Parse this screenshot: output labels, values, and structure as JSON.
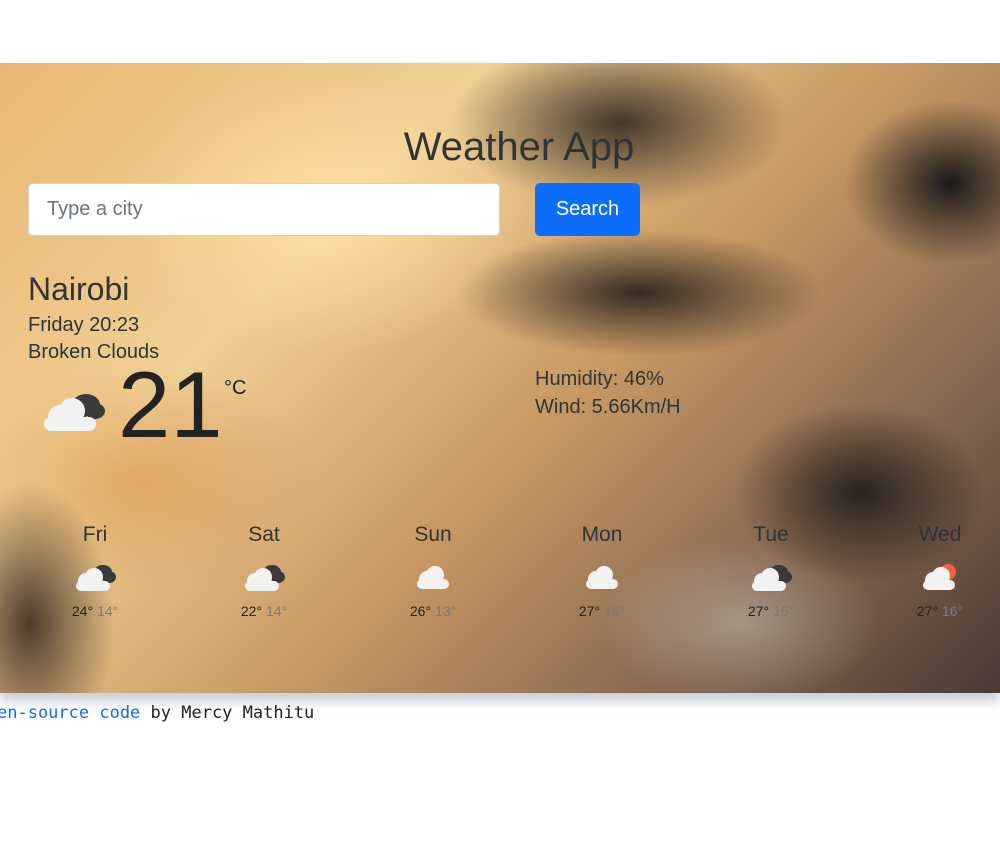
{
  "app": {
    "title": "Weather App"
  },
  "search": {
    "placeholder": "Type a city",
    "value": "",
    "button_label": "Search"
  },
  "current": {
    "city": "Nairobi",
    "datetime": "Friday 20:23",
    "description": "Broken Clouds",
    "icon": "broken-clouds-icon",
    "temperature": "21",
    "unit": "°C",
    "humidity": "Humidity: 46%",
    "wind": "Wind: 5.66Km/H"
  },
  "forecast": [
    {
      "day": "Fri",
      "icon": "broken-clouds-icon",
      "max": "24°",
      "min": "14°"
    },
    {
      "day": "Sat",
      "icon": "broken-clouds-icon",
      "max": "22°",
      "min": "14°"
    },
    {
      "day": "Sun",
      "icon": "cloud-icon",
      "max": "26°",
      "min": "13°"
    },
    {
      "day": "Mon",
      "icon": "cloud-icon",
      "max": "27°",
      "min": "16°"
    },
    {
      "day": "Tue",
      "icon": "broken-clouds-icon",
      "max": "27°",
      "min": "16°"
    },
    {
      "day": "Wed",
      "icon": "few-clouds-icon",
      "max": "27°",
      "min": "16°"
    }
  ],
  "footer": {
    "link_text": "en-source code",
    "suffix": " by Mercy Mathitu"
  },
  "colors": {
    "search_button": "#0d6efd",
    "link": "#0d6efd",
    "sun": "#f0633b"
  }
}
